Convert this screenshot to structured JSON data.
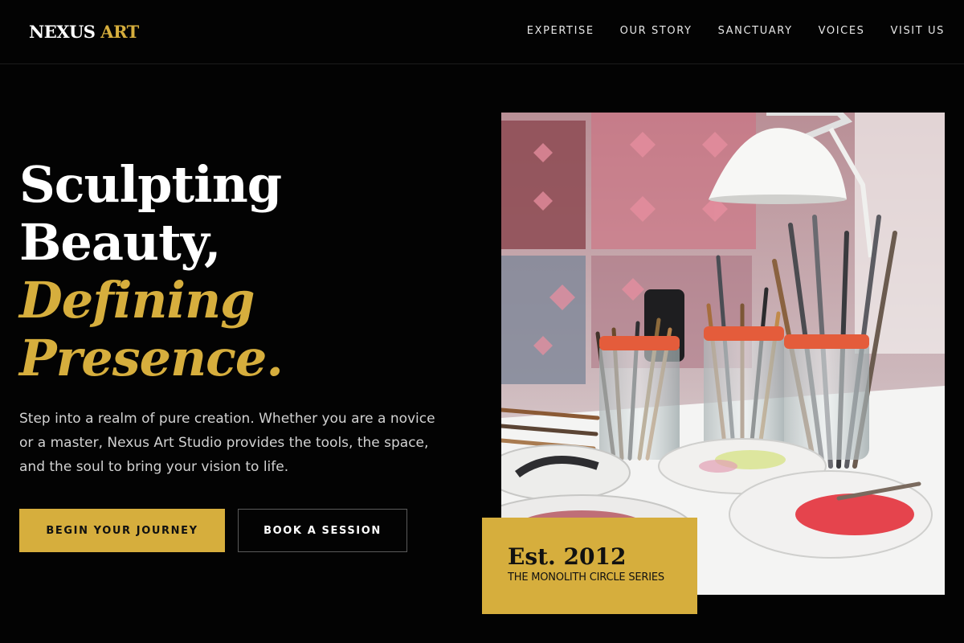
{
  "brand": {
    "name": "NEXUS",
    "accent": "ART"
  },
  "nav": {
    "items": [
      {
        "label": "EXPERTISE"
      },
      {
        "label": "OUR STORY"
      },
      {
        "label": "SANCTUARY"
      },
      {
        "label": "VOICES"
      },
      {
        "label": "VISIT US"
      }
    ]
  },
  "hero": {
    "title_line1": "Sculpting",
    "title_line2": "Beauty,",
    "title_line3": "Defining",
    "title_line4": "Presence.",
    "description": "Step into a realm of pure creation. Whether you are a novice or a master, Nexus Art Studio provides the tools, the space, and the soul to bring your vision to life.",
    "primary_button": "BEGIN YOUR JOURNEY",
    "secondary_button": "BOOK A SESSION"
  },
  "badge": {
    "year": "Est. 2012",
    "subtitle": "THE MONOLITH CIRCLE SERIES"
  },
  "colors": {
    "background": "#030303",
    "accent": "#d6ae3d",
    "text": "#ffffff"
  },
  "image": {
    "subject": "paint brushes in glass jars with paint palettes and a white lamp"
  }
}
